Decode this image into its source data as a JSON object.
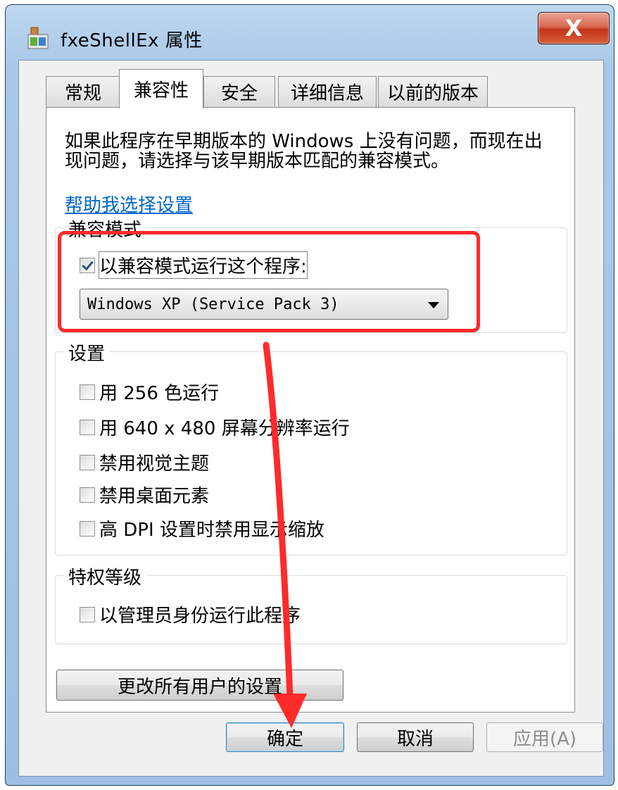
{
  "window": {
    "title": "fxeShellEx 属性",
    "close_label": "X"
  },
  "tabs": [
    {
      "label": "常规",
      "active": false
    },
    {
      "label": "兼容性",
      "active": true
    },
    {
      "label": "安全",
      "active": false
    },
    {
      "label": "详细信息",
      "active": false
    },
    {
      "label": "以前的版本",
      "active": false
    }
  ],
  "page": {
    "description_line1": "如果此程序在早期版本的 Windows 上没有问题，而现在出",
    "description_line2": "现问题，请选择与该早期版本匹配的兼容模式。",
    "help_link": "帮助我选择设置"
  },
  "compat_group": {
    "label": "兼容模式",
    "checkbox_label": "以兼容模式运行这个程序:",
    "checkbox_checked": true,
    "selected_os": "Windows XP (Service Pack 3)"
  },
  "settings_group": {
    "label": "设置",
    "items": [
      {
        "label": "用 256 色运行",
        "checked": false
      },
      {
        "label": "用 640 x 480 屏幕分辨率运行",
        "checked": false
      },
      {
        "label": "禁用视觉主题",
        "checked": false
      },
      {
        "label": "禁用桌面元素",
        "checked": false
      },
      {
        "label": "高 DPI 设置时禁用显示缩放",
        "checked": false
      }
    ]
  },
  "privilege_group": {
    "label": "特权等级",
    "checkbox_label": "以管理员身份运行此程序",
    "checked": false
  },
  "change_all_button": "更改所有用户的设置",
  "buttons": {
    "ok": "确定",
    "cancel": "取消",
    "apply": "应用(A)"
  },
  "colors": {
    "highlight": "#ff2a2a",
    "arrow": "#ff2a2a",
    "link": "#0066cc"
  }
}
